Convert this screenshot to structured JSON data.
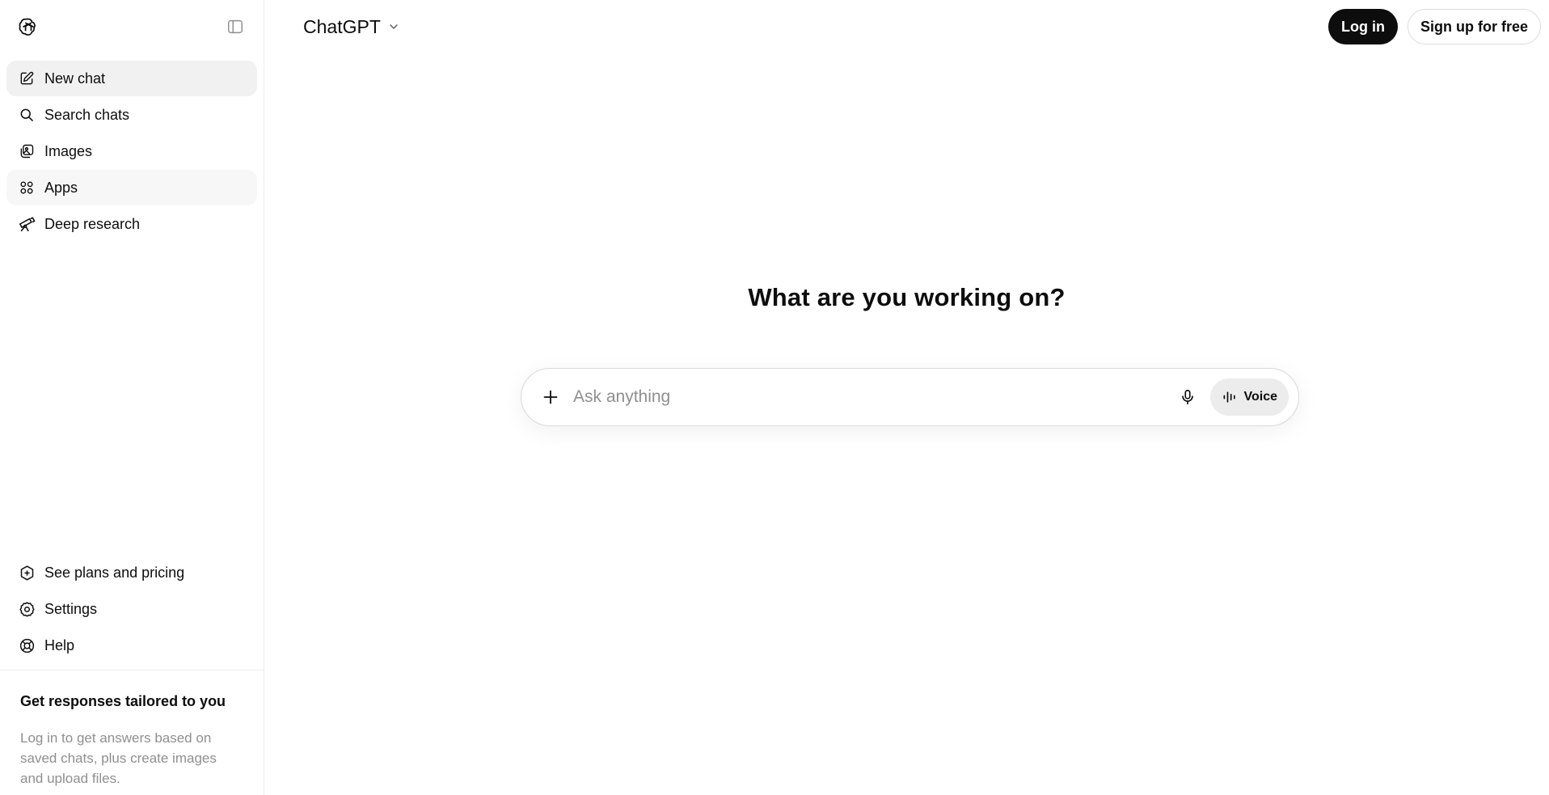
{
  "sidebar": {
    "nav": [
      {
        "label": "New chat",
        "icon": "edit-icon"
      },
      {
        "label": "Search chats",
        "icon": "search-icon"
      },
      {
        "label": "Images",
        "icon": "images-icon"
      },
      {
        "label": "Apps",
        "icon": "apps-grid-icon"
      },
      {
        "label": "Deep research",
        "icon": "telescope-icon"
      }
    ],
    "bottom": [
      {
        "label": "See plans and pricing",
        "icon": "plans-badge-icon"
      },
      {
        "label": "Settings",
        "icon": "gear-icon"
      },
      {
        "label": "Help",
        "icon": "lifebuoy-icon"
      }
    ],
    "promo": {
      "title": "Get responses tailored to you",
      "text": "Log in to get answers based on saved chats, plus create images and upload files."
    }
  },
  "header": {
    "model_label": "ChatGPT",
    "login_label": "Log in",
    "signup_label": "Sign up for free"
  },
  "main": {
    "hero_title": "What are you working on?",
    "composer": {
      "placeholder": "Ask anything",
      "value": "",
      "voice_label": "Voice"
    }
  },
  "colors": {
    "text": "#0d0d0d",
    "muted": "#8f8f8f",
    "active_bg": "#f1f1f1",
    "button_dark": "#0d0d0d",
    "voice_bg": "#ececec"
  }
}
